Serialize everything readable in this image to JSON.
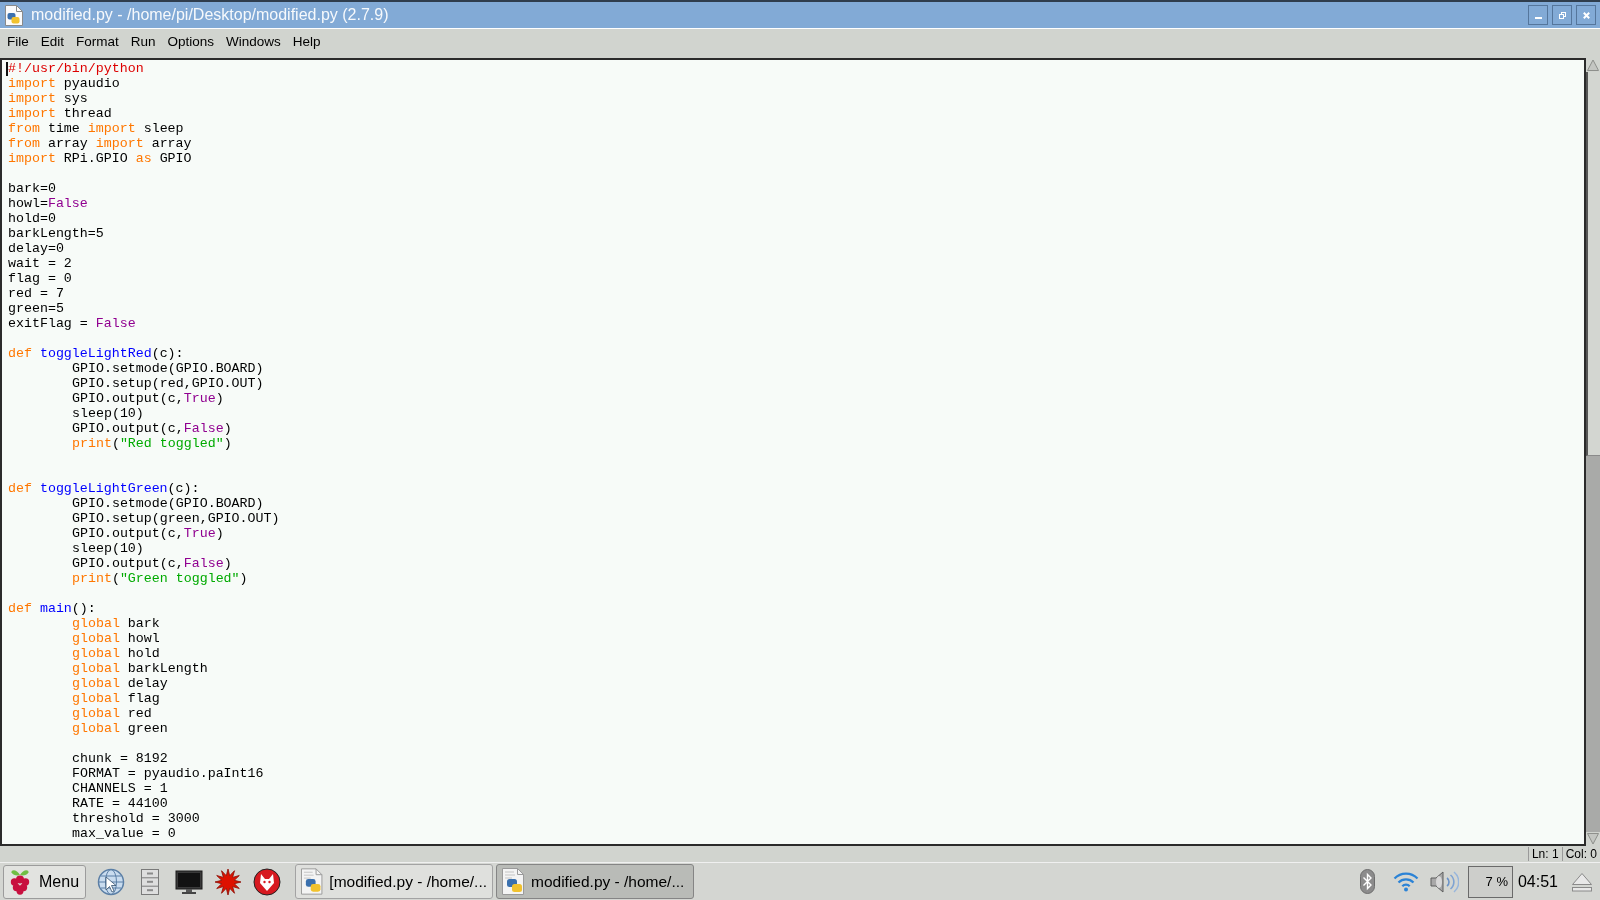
{
  "window": {
    "title": "modified.py - /home/pi/Desktop/modified.py (2.7.9)"
  },
  "menu": [
    {
      "label": "File"
    },
    {
      "label": "Edit"
    },
    {
      "label": "Format"
    },
    {
      "label": "Run"
    },
    {
      "label": "Options"
    },
    {
      "label": "Windows"
    },
    {
      "label": "Help"
    }
  ],
  "editor": {
    "lines": [
      {
        "kind": "code",
        "cursor": true,
        "tokens": [
          {
            "text": "#!/usr/bin/python",
            "kind": "comment"
          }
        ]
      },
      {
        "kind": "code",
        "tokens": [
          {
            "text": "import",
            "kind": "keyword"
          },
          {
            "text": " pyaudio",
            "kind": "plain"
          }
        ]
      },
      {
        "kind": "code",
        "tokens": [
          {
            "text": "import",
            "kind": "keyword"
          },
          {
            "text": " sys",
            "kind": "plain"
          }
        ]
      },
      {
        "kind": "code",
        "tokens": [
          {
            "text": "import",
            "kind": "keyword"
          },
          {
            "text": " thread",
            "kind": "plain"
          }
        ]
      },
      {
        "kind": "code",
        "tokens": [
          {
            "text": "from",
            "kind": "keyword"
          },
          {
            "text": " time ",
            "kind": "plain"
          },
          {
            "text": "import",
            "kind": "keyword"
          },
          {
            "text": " sleep",
            "kind": "plain"
          }
        ]
      },
      {
        "kind": "code",
        "tokens": [
          {
            "text": "from",
            "kind": "keyword"
          },
          {
            "text": " array ",
            "kind": "plain"
          },
          {
            "text": "import",
            "kind": "keyword"
          },
          {
            "text": " array",
            "kind": "plain"
          }
        ]
      },
      {
        "kind": "code",
        "tokens": [
          {
            "text": "import",
            "kind": "keyword"
          },
          {
            "text": " RPi.GPIO ",
            "kind": "plain"
          },
          {
            "text": "as",
            "kind": "keyword"
          },
          {
            "text": " GPIO",
            "kind": "plain"
          }
        ]
      },
      {
        "kind": "blank"
      },
      {
        "kind": "code",
        "tokens": [
          {
            "text": "bark=0",
            "kind": "plain"
          }
        ]
      },
      {
        "kind": "code",
        "tokens": [
          {
            "text": "howl=",
            "kind": "plain"
          },
          {
            "text": "False",
            "kind": "builtin"
          }
        ]
      },
      {
        "kind": "code",
        "tokens": [
          {
            "text": "hold=0",
            "kind": "plain"
          }
        ]
      },
      {
        "kind": "code",
        "tokens": [
          {
            "text": "barkLength=5",
            "kind": "plain"
          }
        ]
      },
      {
        "kind": "code",
        "tokens": [
          {
            "text": "delay=0",
            "kind": "plain"
          }
        ]
      },
      {
        "kind": "code",
        "tokens": [
          {
            "text": "wait = 2",
            "kind": "plain"
          }
        ]
      },
      {
        "kind": "code",
        "tokens": [
          {
            "text": "flag = 0",
            "kind": "plain"
          }
        ]
      },
      {
        "kind": "code",
        "tokens": [
          {
            "text": "red = 7",
            "kind": "plain"
          }
        ]
      },
      {
        "kind": "code",
        "tokens": [
          {
            "text": "green=5",
            "kind": "plain"
          }
        ]
      },
      {
        "kind": "code",
        "tokens": [
          {
            "text": "exitFlag = ",
            "kind": "plain"
          },
          {
            "text": "False",
            "kind": "builtin"
          }
        ]
      },
      {
        "kind": "blank"
      },
      {
        "kind": "code",
        "tokens": [
          {
            "text": "def",
            "kind": "keyword"
          },
          {
            "text": " toggleLightRed",
            "kind": "definition"
          },
          {
            "text": "(c):",
            "kind": "plain"
          }
        ],
        "children": [
          {
            "kind": "code",
            "tokens": [
              {
                "text": "GPIO.setmode(GPIO.BOARD)",
                "kind": "plain"
              }
            ]
          },
          {
            "kind": "code",
            "tokens": [
              {
                "text": "GPIO.setup(red,GPIO.OUT)",
                "kind": "plain"
              }
            ]
          },
          {
            "kind": "code",
            "tokens": [
              {
                "text": "GPIO.output(c,",
                "kind": "plain"
              },
              {
                "text": "True",
                "kind": "builtin"
              },
              {
                "text": ")",
                "kind": "plain"
              }
            ]
          },
          {
            "kind": "code",
            "tokens": [
              {
                "text": "sleep(10)",
                "kind": "plain"
              }
            ]
          },
          {
            "kind": "code",
            "tokens": [
              {
                "text": "GPIO.output(c,",
                "kind": "plain"
              },
              {
                "text": "False",
                "kind": "builtin"
              },
              {
                "text": ")",
                "kind": "plain"
              }
            ]
          },
          {
            "kind": "code",
            "tokens": [
              {
                "text": "print",
                "kind": "keyword"
              },
              {
                "text": "(",
                "kind": "plain"
              },
              {
                "text": "\"Red toggled\"",
                "kind": "string"
              },
              {
                "text": ")",
                "kind": "plain"
              }
            ]
          }
        ]
      },
      {
        "kind": "blank"
      },
      {
        "kind": "blank"
      },
      {
        "kind": "code",
        "tokens": [
          {
            "text": "def",
            "kind": "keyword"
          },
          {
            "text": " toggleLightGreen",
            "kind": "definition"
          },
          {
            "text": "(c):",
            "kind": "plain"
          }
        ],
        "children": [
          {
            "kind": "code",
            "tokens": [
              {
                "text": "GPIO.setmode(GPIO.BOARD)",
                "kind": "plain"
              }
            ]
          },
          {
            "kind": "code",
            "tokens": [
              {
                "text": "GPIO.setup(green,GPIO.OUT)",
                "kind": "plain"
              }
            ]
          },
          {
            "kind": "code",
            "tokens": [
              {
                "text": "GPIO.output(c,",
                "kind": "plain"
              },
              {
                "text": "True",
                "kind": "builtin"
              },
              {
                "text": ")",
                "kind": "plain"
              }
            ]
          },
          {
            "kind": "code",
            "tokens": [
              {
                "text": "sleep(10)",
                "kind": "plain"
              }
            ]
          },
          {
            "kind": "code",
            "tokens": [
              {
                "text": "GPIO.output(c,",
                "kind": "plain"
              },
              {
                "text": "False",
                "kind": "builtin"
              },
              {
                "text": ")",
                "kind": "plain"
              }
            ]
          },
          {
            "kind": "code",
            "tokens": [
              {
                "text": "print",
                "kind": "keyword"
              },
              {
                "text": "(",
                "kind": "plain"
              },
              {
                "text": "\"Green toggled\"",
                "kind": "string"
              },
              {
                "text": ")",
                "kind": "plain"
              }
            ]
          }
        ]
      },
      {
        "kind": "blank"
      },
      {
        "kind": "code",
        "tokens": [
          {
            "text": "def",
            "kind": "keyword"
          },
          {
            "text": " main",
            "kind": "definition"
          },
          {
            "text": "():",
            "kind": "plain"
          }
        ],
        "children": [
          {
            "kind": "code",
            "tokens": [
              {
                "text": "global",
                "kind": "keyword"
              },
              {
                "text": " bark",
                "kind": "plain"
              }
            ]
          },
          {
            "kind": "code",
            "tokens": [
              {
                "text": "global",
                "kind": "keyword"
              },
              {
                "text": " howl",
                "kind": "plain"
              }
            ]
          },
          {
            "kind": "code",
            "tokens": [
              {
                "text": "global",
                "kind": "keyword"
              },
              {
                "text": " hold",
                "kind": "plain"
              }
            ]
          },
          {
            "kind": "code",
            "tokens": [
              {
                "text": "global",
                "kind": "keyword"
              },
              {
                "text": " barkLength",
                "kind": "plain"
              }
            ]
          },
          {
            "kind": "code",
            "tokens": [
              {
                "text": "global",
                "kind": "keyword"
              },
              {
                "text": " delay",
                "kind": "plain"
              }
            ]
          },
          {
            "kind": "code",
            "tokens": [
              {
                "text": "global",
                "kind": "keyword"
              },
              {
                "text": " flag",
                "kind": "plain"
              }
            ]
          },
          {
            "kind": "code",
            "tokens": [
              {
                "text": "global",
                "kind": "keyword"
              },
              {
                "text": " red",
                "kind": "plain"
              }
            ]
          },
          {
            "kind": "code",
            "tokens": [
              {
                "text": "global",
                "kind": "keyword"
              },
              {
                "text": " green",
                "kind": "plain"
              }
            ]
          },
          {
            "kind": "blank"
          },
          {
            "kind": "code",
            "tokens": [
              {
                "text": "chunk = 8192",
                "kind": "plain"
              }
            ]
          },
          {
            "kind": "code",
            "tokens": [
              {
                "text": "FORMAT = pyaudio.paInt16",
                "kind": "plain"
              }
            ]
          },
          {
            "kind": "code",
            "tokens": [
              {
                "text": "CHANNELS = 1",
                "kind": "plain"
              }
            ]
          },
          {
            "kind": "code",
            "tokens": [
              {
                "text": "RATE = 44100",
                "kind": "plain"
              }
            ]
          },
          {
            "kind": "code",
            "tokens": [
              {
                "text": "threshold = 3000",
                "kind": "plain"
              }
            ]
          },
          {
            "kind": "code",
            "tokens": [
              {
                "text": "max_value = 0",
                "kind": "plain"
              }
            ]
          }
        ]
      }
    ]
  },
  "status_bar": {
    "line": "Ln: 1",
    "column": "Col: 0"
  },
  "taskbar": {
    "menu_button": "Menu",
    "tasks": [
      {
        "label": "[modified.py - /home/...",
        "selected": false
      },
      {
        "label": "modified.py - /home/...",
        "selected": true
      }
    ],
    "cpu_usage": "7 %",
    "clock": "04:51"
  }
}
